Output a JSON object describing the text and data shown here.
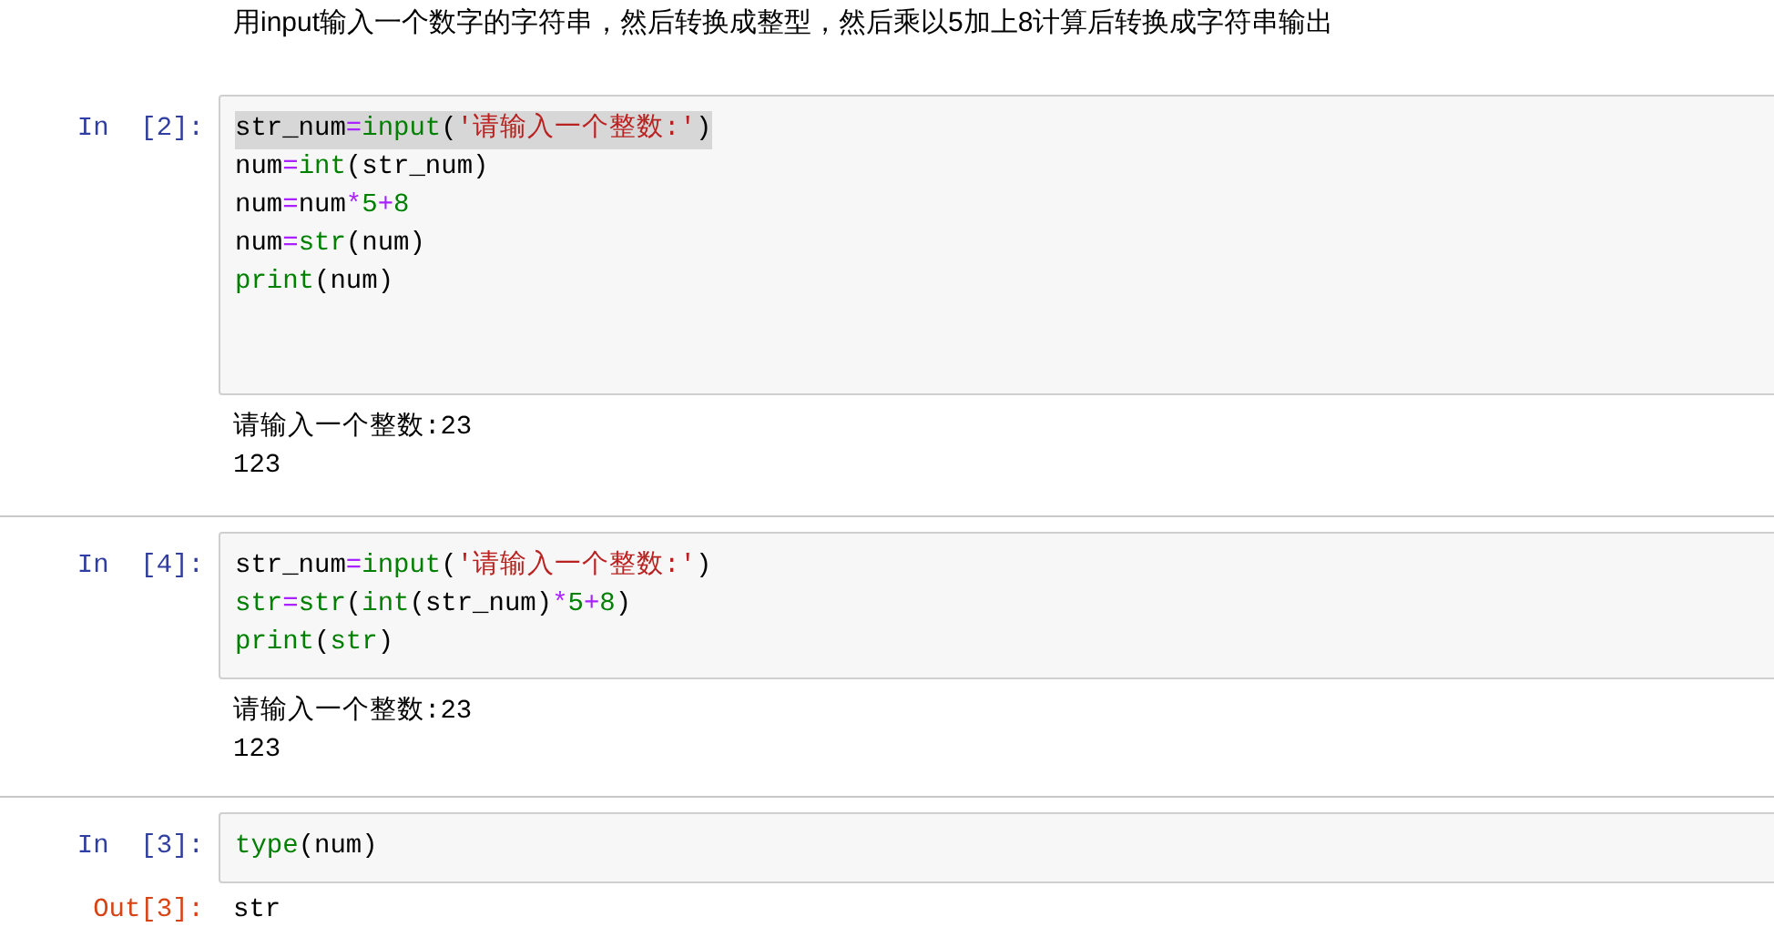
{
  "markdown": "用input输入一个数字的字符串，然后转换成整型，然后乘以5加上8计算后转换成字符串输出",
  "cells": [
    {
      "prompt": "In  [2]:",
      "code": [
        {
          "kind": "code",
          "highlighted": true,
          "tokens": [
            {
              "kind": "name",
              "text": "str_num"
            },
            {
              "kind": "op",
              "text": "="
            },
            {
              "kind": "builtin",
              "text": "input"
            },
            {
              "kind": "punct",
              "text": "("
            },
            {
              "kind": "string",
              "text": "'请输入一个整数:'"
            },
            {
              "kind": "punct",
              "text": ")"
            }
          ]
        },
        {
          "kind": "code",
          "highlighted": false,
          "tokens": [
            {
              "kind": "name",
              "text": "num"
            },
            {
              "kind": "op",
              "text": "="
            },
            {
              "kind": "builtin",
              "text": "int"
            },
            {
              "kind": "punct",
              "text": "("
            },
            {
              "kind": "name",
              "text": "str_num"
            },
            {
              "kind": "punct",
              "text": ")"
            }
          ]
        },
        {
          "kind": "code",
          "highlighted": false,
          "tokens": [
            {
              "kind": "name",
              "text": "num"
            },
            {
              "kind": "op",
              "text": "="
            },
            {
              "kind": "name",
              "text": "num"
            },
            {
              "kind": "op",
              "text": "*"
            },
            {
              "kind": "number",
              "text": "5"
            },
            {
              "kind": "op",
              "text": "+"
            },
            {
              "kind": "number",
              "text": "8"
            }
          ]
        },
        {
          "kind": "code",
          "highlighted": false,
          "tokens": [
            {
              "kind": "name",
              "text": "num"
            },
            {
              "kind": "op",
              "text": "="
            },
            {
              "kind": "builtin",
              "text": "str"
            },
            {
              "kind": "punct",
              "text": "("
            },
            {
              "kind": "name",
              "text": "num"
            },
            {
              "kind": "punct",
              "text": ")"
            }
          ]
        },
        {
          "kind": "code",
          "highlighted": false,
          "tokens": [
            {
              "kind": "builtin",
              "text": "print"
            },
            {
              "kind": "punct",
              "text": "("
            },
            {
              "kind": "name",
              "text": "num"
            },
            {
              "kind": "punct",
              "text": ")"
            }
          ]
        },
        {
          "kind": "blank"
        },
        {
          "kind": "blank"
        }
      ],
      "output": {
        "lines": [
          "请输入一个整数:23",
          "123"
        ]
      }
    },
    {
      "prompt": "In  [4]:",
      "code": [
        {
          "kind": "code",
          "highlighted": false,
          "tokens": [
            {
              "kind": "name",
              "text": "str_num"
            },
            {
              "kind": "op",
              "text": "="
            },
            {
              "kind": "builtin",
              "text": "input"
            },
            {
              "kind": "punct",
              "text": "("
            },
            {
              "kind": "string",
              "text": "'请输入一个整数:'"
            },
            {
              "kind": "punct",
              "text": ")"
            }
          ]
        },
        {
          "kind": "code",
          "highlighted": false,
          "tokens": [
            {
              "kind": "builtin",
              "text": "str"
            },
            {
              "kind": "op",
              "text": "="
            },
            {
              "kind": "builtin",
              "text": "str"
            },
            {
              "kind": "punct",
              "text": "("
            },
            {
              "kind": "builtin",
              "text": "int"
            },
            {
              "kind": "punct",
              "text": "("
            },
            {
              "kind": "name",
              "text": "str_num"
            },
            {
              "kind": "punct",
              "text": ")"
            },
            {
              "kind": "op",
              "text": "*"
            },
            {
              "kind": "number",
              "text": "5"
            },
            {
              "kind": "op",
              "text": "+"
            },
            {
              "kind": "number",
              "text": "8"
            },
            {
              "kind": "punct",
              "text": ")"
            }
          ]
        },
        {
          "kind": "code",
          "highlighted": false,
          "tokens": [
            {
              "kind": "builtin",
              "text": "print"
            },
            {
              "kind": "punct",
              "text": "("
            },
            {
              "kind": "builtin",
              "text": "str"
            },
            {
              "kind": "punct",
              "text": ")"
            }
          ]
        }
      ],
      "output": {
        "lines": [
          "请输入一个整数:23",
          "123"
        ]
      }
    },
    {
      "prompt": "In  [3]:",
      "code": [
        {
          "kind": "code",
          "highlighted": false,
          "tokens": [
            {
              "kind": "builtin",
              "text": "type"
            },
            {
              "kind": "punct",
              "text": "("
            },
            {
              "kind": "name",
              "text": "num"
            },
            {
              "kind": "punct",
              "text": ")"
            }
          ]
        }
      ],
      "output": {
        "prompt": "Out[3]:",
        "lines": [
          "str"
        ]
      }
    }
  ]
}
